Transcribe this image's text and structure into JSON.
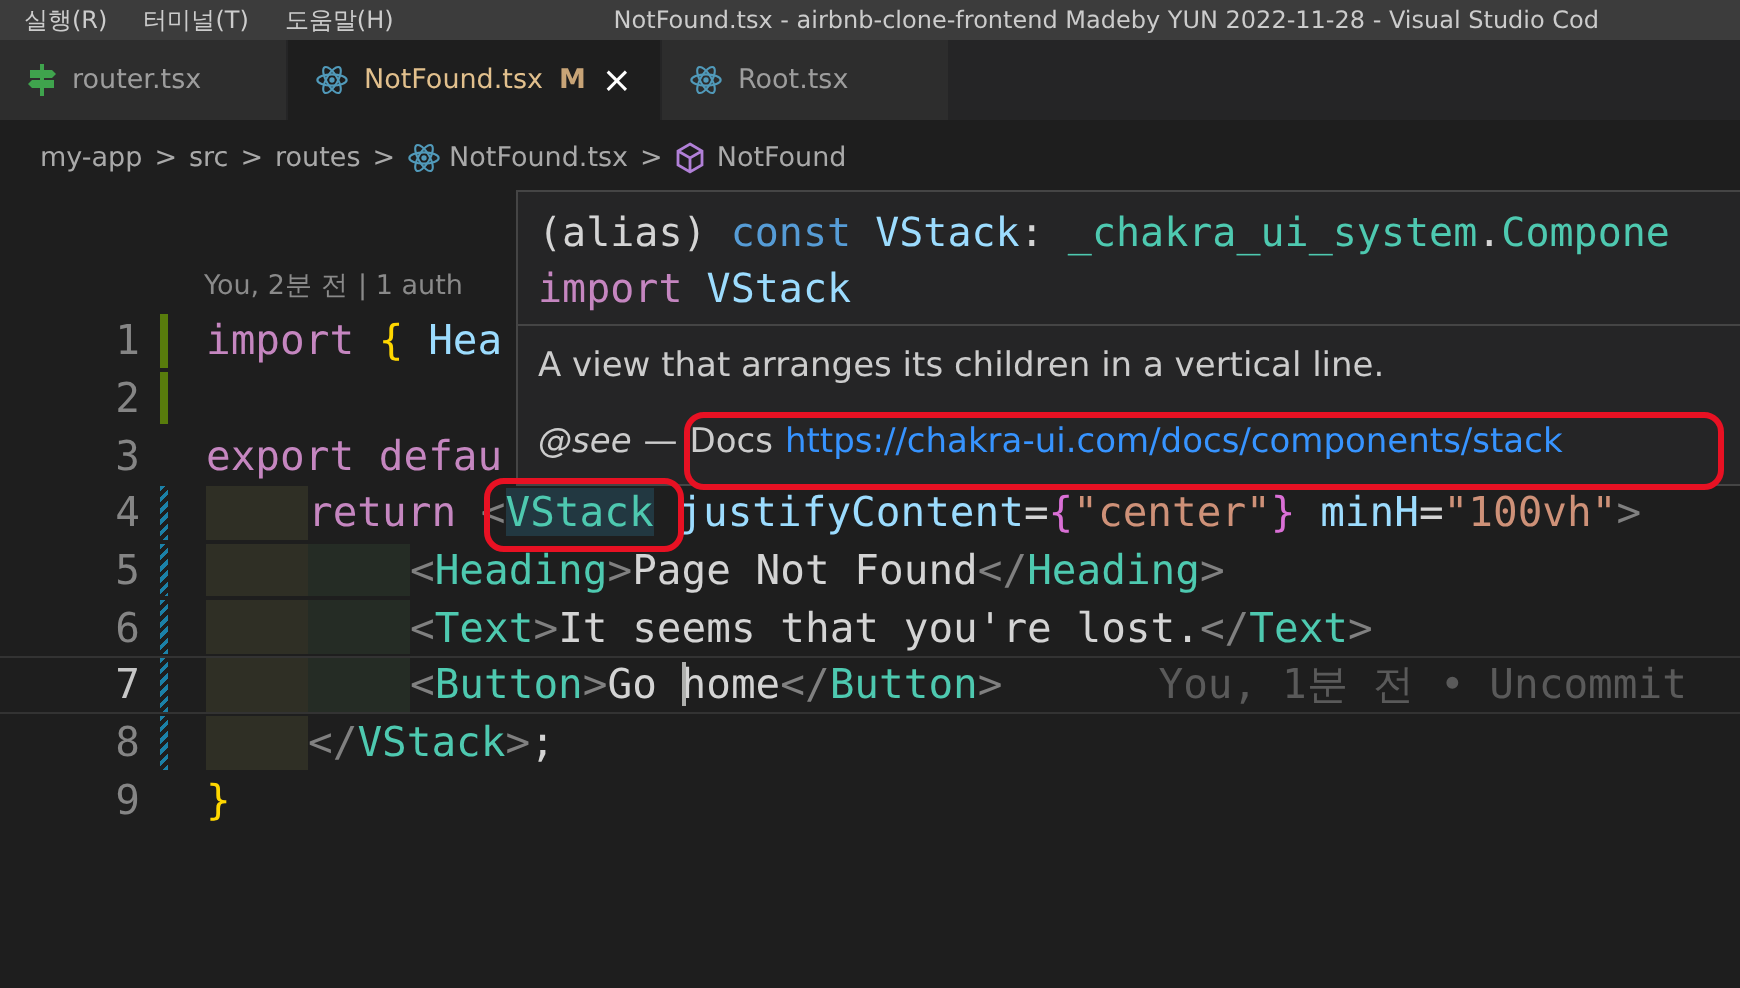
{
  "title_bar": {
    "menus": [
      "실행(R)",
      "터미널(T)",
      "도움말(H)"
    ],
    "title": "NotFound.tsx - airbnb-clone-frontend Madeby YUN 2022-11-28 - Visual Studio Cod"
  },
  "tabs": [
    {
      "label": "router.tsx",
      "kind": "route",
      "selected": false
    },
    {
      "label": "NotFound.tsx",
      "kind": "react",
      "selected": true,
      "status": "M",
      "close": "×"
    },
    {
      "label": "Root.tsx",
      "kind": "react",
      "selected": false
    }
  ],
  "breadcrumb": [
    {
      "label": "my-app",
      "kind": "folder"
    },
    {
      "label": "src",
      "kind": "folder"
    },
    {
      "label": "routes",
      "kind": "folder"
    },
    {
      "label": "NotFound.tsx",
      "kind": "react"
    },
    {
      "label": "NotFound",
      "kind": "component"
    }
  ],
  "breadcrumb_separator": ">",
  "codelens": "You, 2분 전 | 1 auth",
  "lines": [
    {
      "number": "1",
      "added": true,
      "modified": false,
      "active": false,
      "tokens": [
        {
          "text": "import ",
          "kind": "keyword"
        },
        {
          "text": "{",
          "kind": "brace"
        },
        {
          "text": " Hea",
          "kind": "var"
        }
      ]
    },
    {
      "number": "2",
      "added": true,
      "modified": false,
      "active": false
    },
    {
      "number": "3",
      "added": false,
      "modified": false,
      "active": false,
      "tokens": [
        {
          "text": "export defau",
          "kind": "keyword"
        }
      ],
      "children": [
        {
          "number": "4",
          "added": false,
          "modified": true,
          "active": false,
          "tokens": [
            {
              "text": "return ",
              "kind": "keyword"
            },
            {
              "text": "<",
              "kind": "punct"
            },
            {
              "text": "VStack",
              "kind": "tag",
              "highlighted": true
            },
            {
              "text": " justifyContent",
              "kind": "attr"
            },
            {
              "text": "=",
              "kind": "plain"
            },
            {
              "text": "{",
              "kind": "brace2"
            },
            {
              "text": "\"center\"",
              "kind": "string"
            },
            {
              "text": "}",
              "kind": "brace2"
            },
            {
              "text": " minH",
              "kind": "attr"
            },
            {
              "text": "=",
              "kind": "plain"
            },
            {
              "text": "\"100vh\"",
              "kind": "string"
            },
            {
              "text": ">",
              "kind": "punct"
            }
          ],
          "children": [
            {
              "number": "5",
              "added": false,
              "modified": true,
              "active": false,
              "tokens": [
                {
                  "text": "<",
                  "kind": "punct"
                },
                {
                  "text": "Heading",
                  "kind": "tag"
                },
                {
                  "text": ">",
                  "kind": "punct"
                },
                {
                  "text": "Page Not Found",
                  "kind": "plain"
                },
                {
                  "text": "</",
                  "kind": "punct"
                },
                {
                  "text": "Heading",
                  "kind": "tag"
                },
                {
                  "text": ">",
                  "kind": "punct"
                }
              ]
            },
            {
              "number": "6",
              "added": false,
              "modified": true,
              "active": false,
              "tokens": [
                {
                  "text": "<",
                  "kind": "punct"
                },
                {
                  "text": "Text",
                  "kind": "tag"
                },
                {
                  "text": ">",
                  "kind": "punct"
                },
                {
                  "text": "It seems that you're lost.",
                  "kind": "plain"
                },
                {
                  "text": "</",
                  "kind": "punct"
                },
                {
                  "text": "Text",
                  "kind": "tag"
                },
                {
                  "text": ">",
                  "kind": "punct"
                }
              ]
            },
            {
              "number": "7",
              "added": false,
              "modified": true,
              "active": true,
              "blame": "You, 1분 전 • Uncommit",
              "tokens": [
                {
                  "text": "<",
                  "kind": "punct"
                },
                {
                  "text": "Button",
                  "kind": "tag"
                },
                {
                  "text": ">",
                  "kind": "punct"
                },
                {
                  "text": "Go ",
                  "kind": "plain"
                },
                {
                  "text": "home",
                  "kind": "plain",
                  "cursor": true
                },
                {
                  "text": "</",
                  "kind": "punct"
                },
                {
                  "text": "Button",
                  "kind": "tag"
                },
                {
                  "text": ">",
                  "kind": "punct"
                }
              ]
            }
          ]
        },
        {
          "number": "8",
          "added": false,
          "modified": true,
          "active": false,
          "tokens": [
            {
              "text": "</",
              "kind": "punct"
            },
            {
              "text": "VStack",
              "kind": "tag"
            },
            {
              "text": ">",
              "kind": "punct"
            },
            {
              "text": ";",
              "kind": "plain"
            }
          ]
        }
      ]
    },
    {
      "number": "9",
      "added": false,
      "modified": false,
      "active": false,
      "tokens": [
        {
          "text": "}",
          "kind": "brace"
        }
      ]
    }
  ],
  "hover": {
    "signature": [
      [
        {
          "text": "(alias) ",
          "kind": "plain"
        },
        {
          "text": "const ",
          "kind": "const"
        },
        {
          "text": "VStack",
          "kind": "var"
        },
        {
          "text": ": ",
          "kind": "plain"
        },
        {
          "text": "_chakra_ui_system",
          "kind": "tag"
        },
        {
          "text": ".",
          "kind": "plain"
        },
        {
          "text": "Compone",
          "kind": "tag"
        }
      ],
      [
        {
          "text": "import ",
          "kind": "keyword"
        },
        {
          "text": "VStack",
          "kind": "var"
        }
      ]
    ],
    "description": "A view that arranges its children in a vertical line.",
    "see_label": "@see",
    "see_dash": "—",
    "docs_label": "Docs",
    "docs_link": "https://chakra-ui.com/docs/components/stack"
  }
}
